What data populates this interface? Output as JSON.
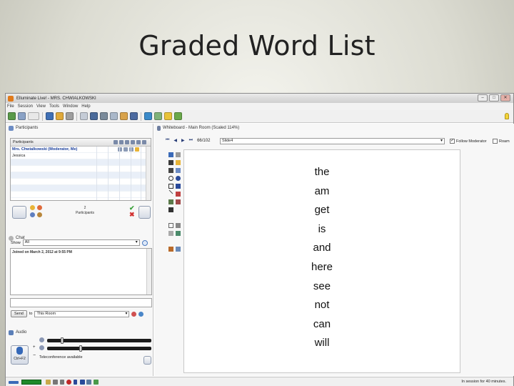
{
  "slide": {
    "title": "Graded Word List"
  },
  "window": {
    "title": "Elluminate Live! - MRS. CHWIALKOWSKI"
  },
  "menu": [
    "File",
    "Session",
    "View",
    "Tools",
    "Window",
    "Help"
  ],
  "participants": {
    "panel_title": "Participants",
    "column_header": "Participants",
    "rows": [
      {
        "name": "Mrs. Chwialkowski (Moderator, Me)"
      },
      {
        "name": "Jessica"
      }
    ],
    "count": "2",
    "count_label": "Participants"
  },
  "chat": {
    "panel_title": "Chat",
    "show_label": "Show",
    "show_value": "All",
    "log": [
      "Joined on March 2, 2012 at 9:55 PM"
    ],
    "send_label": "Send",
    "to_label": "to",
    "to_value": "This Room"
  },
  "audio": {
    "panel_title": "Audio",
    "ctrl_label": "Ctrl+F2",
    "teleconference": "Teleconference available",
    "mic_level": 0.13,
    "speaker_level": 0.31
  },
  "whiteboard": {
    "panel_title": "Whiteboard - Main Room (Scaled 114%)",
    "page": "66/102",
    "slide_name": "Slide4",
    "follow_label": "Follow Moderator",
    "follow_checked": true,
    "roam_label": "Roam",
    "words": [
      "the",
      "am",
      "get",
      "is",
      "and",
      "here",
      "see",
      "not",
      "can",
      "will"
    ]
  },
  "status": {
    "session": "In session for 40 minutes."
  },
  "colors": {
    "accent": "#1a3f9c",
    "meter": "#1f8a2a"
  }
}
